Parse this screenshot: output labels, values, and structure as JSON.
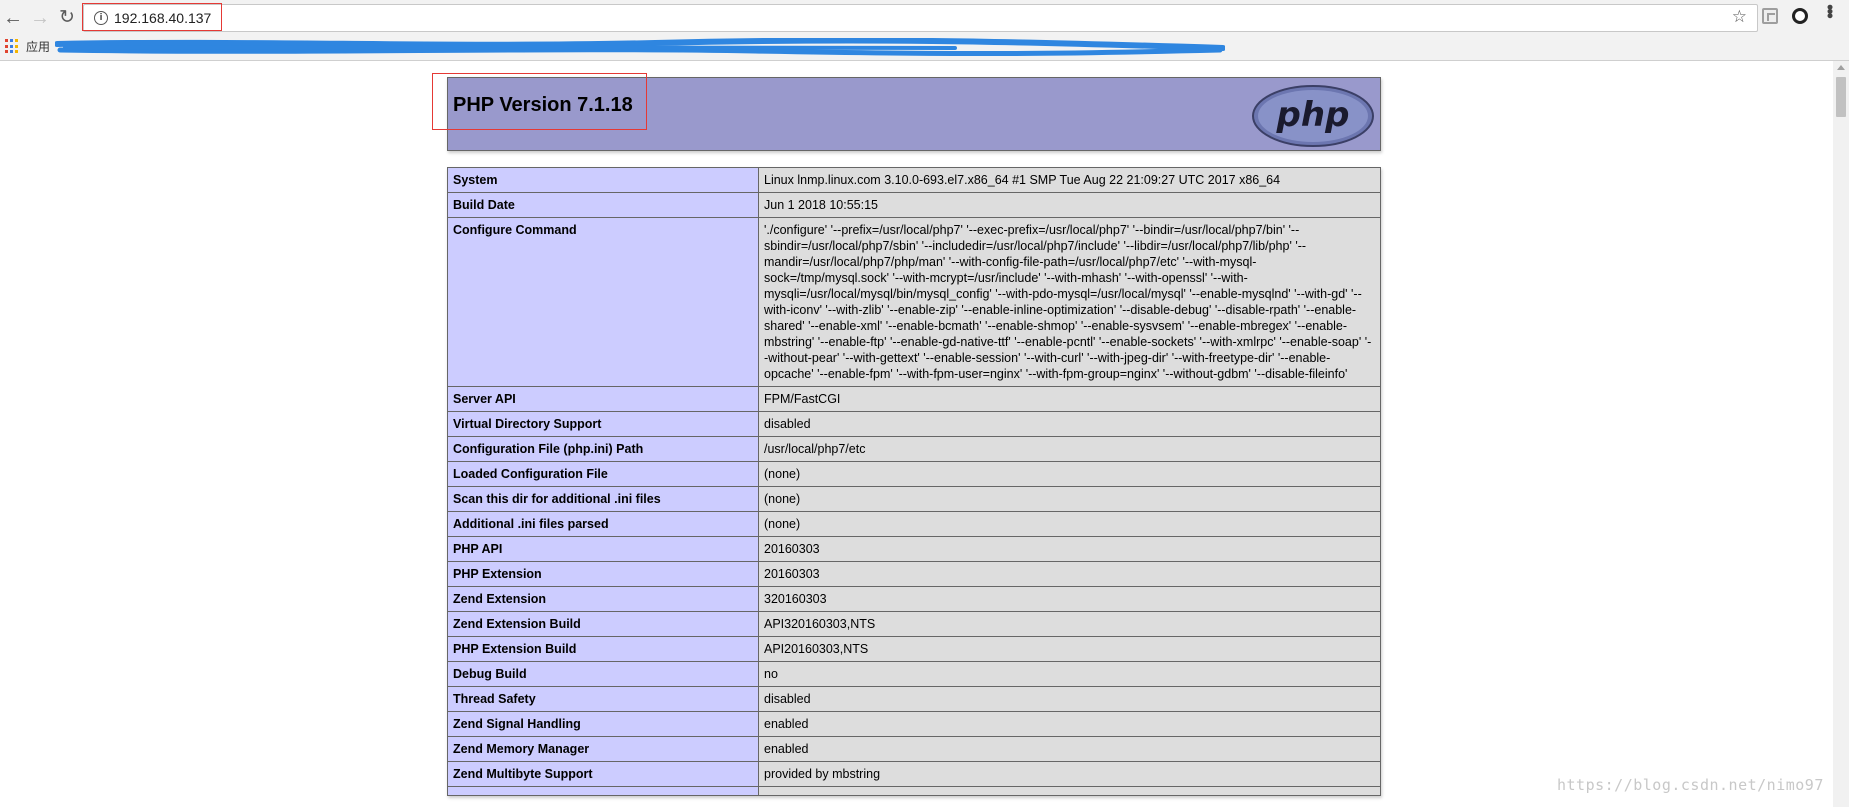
{
  "browser": {
    "url": "192.168.40.137",
    "apps_label": "应用",
    "icons": {
      "back": "back-arrow-icon",
      "forward": "forward-arrow-icon",
      "reload": "reload-icon",
      "info": "info-icon",
      "star": "star-icon",
      "menu": "kebab-menu-icon"
    }
  },
  "page": {
    "title": "PHP Version 7.1.18",
    "logo_text": "php",
    "rows": [
      {
        "key": "System",
        "value": "Linux lnmp.linux.com 3.10.0-693.el7.x86_64 #1 SMP Tue Aug 22 21:09:27 UTC 2017 x86_64"
      },
      {
        "key": "Build Date",
        "value": "Jun 1 2018 10:55:15"
      },
      {
        "key": "Configure Command",
        "value": "'./configure' '--prefix=/usr/local/php7' '--exec-prefix=/usr/local/php7' '--bindir=/usr/local/php7/bin' '--sbindir=/usr/local/php7/sbin' '--includedir=/usr/local/php7/include' '--libdir=/usr/local/php7/lib/php' '--mandir=/usr/local/php7/php/man' '--with-config-file-path=/usr/local/php7/etc' '--with-mysql-sock=/tmp/mysql.sock' '--with-mcrypt=/usr/include' '--with-mhash' '--with-openssl' '--with-mysqli=/usr/local/mysql/bin/mysql_config' '--with-pdo-mysql=/usr/local/mysql' '--enable-mysqlnd' '--with-gd' '--with-iconv' '--with-zlib' '--enable-zip' '--enable-inline-optimization' '--disable-debug' '--disable-rpath' '--enable-shared' '--enable-xml' '--enable-bcmath' '--enable-shmop' '--enable-sysvsem' '--enable-mbregex' '--enable-mbstring' '--enable-ftp' '--enable-gd-native-ttf' '--enable-pcntl' '--enable-sockets' '--with-xmlrpc' '--enable-soap' '--without-pear' '--with-gettext' '--enable-session' '--with-curl' '--with-jpeg-dir' '--with-freetype-dir' '--enable-opcache' '--enable-fpm' '--with-fpm-user=nginx' '--with-fpm-group=nginx' '--without-gdbm' '--disable-fileinfo'"
      },
      {
        "key": "Server API",
        "value": "FPM/FastCGI"
      },
      {
        "key": "Virtual Directory Support",
        "value": "disabled"
      },
      {
        "key": "Configuration File (php.ini) Path",
        "value": "/usr/local/php7/etc"
      },
      {
        "key": "Loaded Configuration File",
        "value": "(none)"
      },
      {
        "key": "Scan this dir for additional .ini files",
        "value": "(none)"
      },
      {
        "key": "Additional .ini files parsed",
        "value": "(none)"
      },
      {
        "key": "PHP API",
        "value": "20160303"
      },
      {
        "key": "PHP Extension",
        "value": "20160303"
      },
      {
        "key": "Zend Extension",
        "value": "320160303"
      },
      {
        "key": "Zend Extension Build",
        "value": "API320160303,NTS"
      },
      {
        "key": "PHP Extension Build",
        "value": "API20160303,NTS"
      },
      {
        "key": "Debug Build",
        "value": "no"
      },
      {
        "key": "Thread Safety",
        "value": "disabled"
      },
      {
        "key": "Zend Signal Handling",
        "value": "enabled"
      },
      {
        "key": "Zend Memory Manager",
        "value": "enabled"
      },
      {
        "key": "Zend Multibyte Support",
        "value": "provided by mbstring"
      },
      {
        "key": "",
        "value": ""
      }
    ]
  },
  "watermark": "https://blog.csdn.net/nimo97",
  "colors": {
    "header_bg": "#9999cc",
    "key_bg": "#ccccff",
    "value_bg": "#dddddd",
    "highlight": "#e53935",
    "scribble": "#2f86e0"
  }
}
